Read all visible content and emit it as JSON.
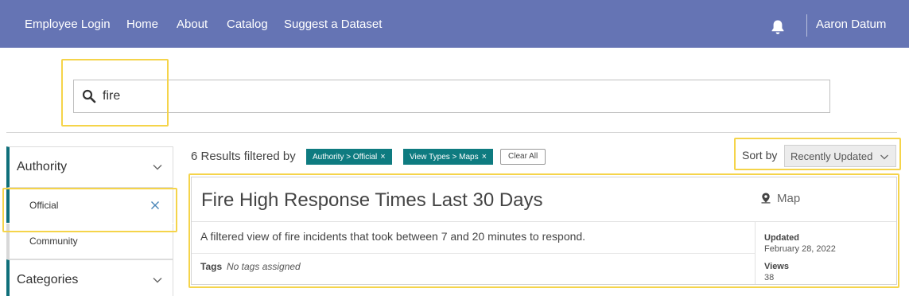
{
  "nav": {
    "links": [
      "Employee Login",
      "Home",
      "About",
      "Catalog",
      "Suggest a Dataset"
    ],
    "user_name": "Aaron Datum",
    "bar_color": "#6574b4",
    "icons": {
      "notifications": "bell-icon"
    }
  },
  "search": {
    "value": "fire",
    "icon": "search-icon"
  },
  "sidebar": {
    "authority": {
      "title": "Authority",
      "options": [
        {
          "label": "Official",
          "selected": true
        },
        {
          "label": "Community",
          "selected": false
        }
      ]
    },
    "categories": {
      "title": "Categories"
    }
  },
  "results": {
    "count_text": "6 Results filtered by",
    "filters": [
      "Authority > Official",
      "View Types > Maps"
    ],
    "filter_remove_glyph": "×",
    "clear_all": "Clear All",
    "sort_label": "Sort by",
    "sort_value": "Recently Updated"
  },
  "card": {
    "title": "Fire High Response Times Last 30 Days",
    "type": "Map",
    "type_icon": "map-pin-icon",
    "description": "A filtered view of fire incidents that took between 7 and 20 minutes to respond.",
    "tags_label": "Tags",
    "tags_value": "No tags assigned",
    "updated_label": "Updated",
    "updated_value": "February 28, 2022",
    "views_label": "Views",
    "views_value": "38"
  },
  "colors": {
    "accent_teal": "#0e7b80",
    "highlight": "#f5d44a"
  }
}
